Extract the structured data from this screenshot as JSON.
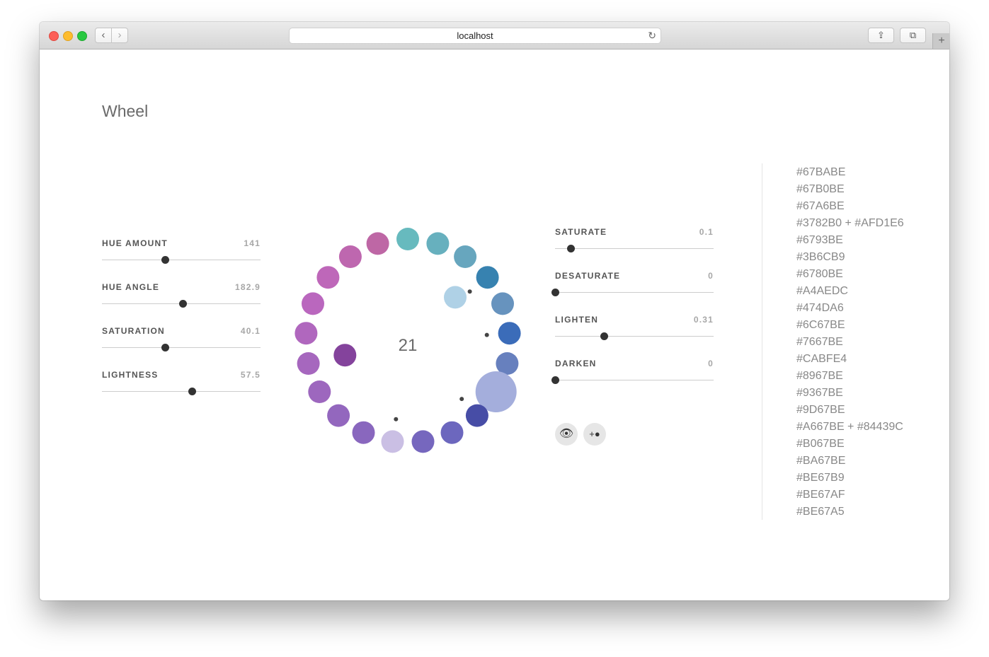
{
  "browser": {
    "url": "localhost",
    "back_icon": "‹",
    "forward_icon": "›",
    "reload_icon": "↻",
    "share_icon": "⇪",
    "tabs_icon": "⧉",
    "new_tab_icon": "+"
  },
  "page": {
    "title": "Wheel"
  },
  "left_controls": [
    {
      "label": "HUE AMOUNT",
      "value": "141",
      "fraction": 0.4
    },
    {
      "label": "HUE ANGLE",
      "value": "182.9",
      "fraction": 0.51
    },
    {
      "label": "SATURATION",
      "value": "40.1",
      "fraction": 0.4
    },
    {
      "label": "LIGHTNESS",
      "value": "57.5",
      "fraction": 0.57
    }
  ],
  "right_controls": [
    {
      "label": "SATURATE",
      "value": "0.1",
      "fraction": 0.1
    },
    {
      "label": "DESATURATE",
      "value": "0",
      "fraction": 0
    },
    {
      "label": "LIGHTEN",
      "value": "0.31",
      "fraction": 0.31
    },
    {
      "label": "DARKEN",
      "value": "0",
      "fraction": 0
    }
  ],
  "buttons": {
    "eye_icon": "👁",
    "add_icon": "+●"
  },
  "wheel": {
    "center_count": "21",
    "outer_dots": [
      "#67BABE",
      "#67B0BE",
      "#67A6BE",
      "#3782B0",
      "#6793BE",
      "#3B6CB9",
      "#6780BE",
      "#A4AEDC",
      "#474DA6",
      "#6C67BE",
      "#7667BE",
      "#CABFE4",
      "#8967BE",
      "#9367BE",
      "#9D67BE",
      "#A667BE",
      "#B067BE",
      "#BA67BE",
      "#BE67B9",
      "#BE67AF",
      "#BE67A5"
    ],
    "inner_dots": [
      "#AFD1E6",
      "#84439C"
    ]
  },
  "hex_list": [
    "#67BABE",
    "#67B0BE",
    "#67A6BE",
    "#3782B0 + #AFD1E6",
    "#6793BE",
    "#3B6CB9",
    "#6780BE",
    "#A4AEDC",
    "#474DA6",
    "#6C67BE",
    "#7667BE",
    "#CABFE4",
    "#8967BE",
    "#9367BE",
    "#9D67BE",
    "#A667BE + #84439C",
    "#B067BE",
    "#BA67BE",
    "#BE67B9",
    "#BE67AF",
    "#BE67A5"
  ]
}
